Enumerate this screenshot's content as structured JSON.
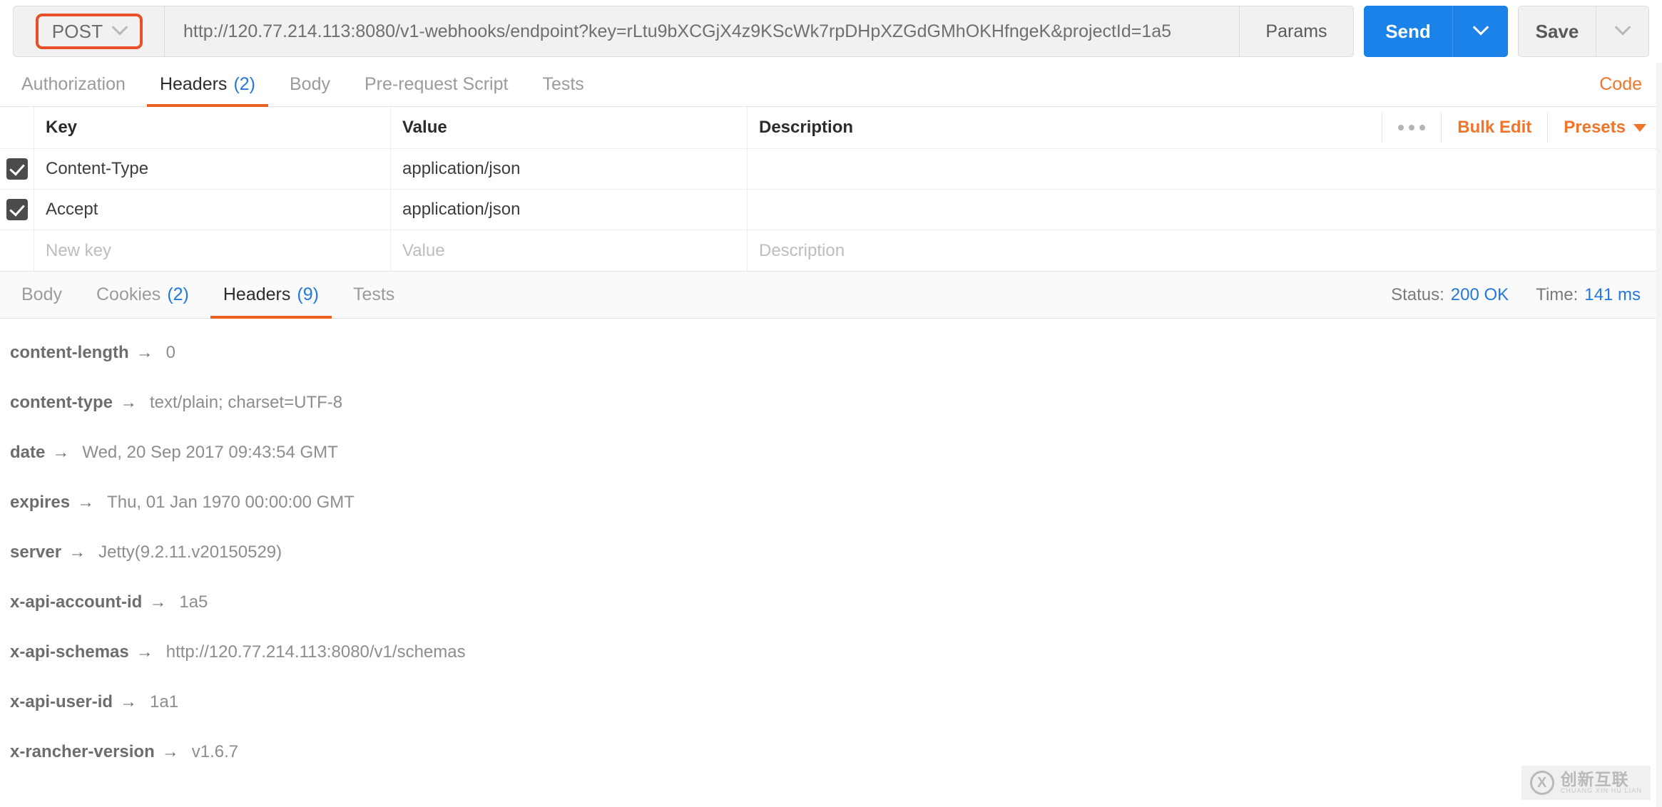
{
  "request": {
    "method": "POST",
    "url": "http://120.77.214.113:8080/v1-webhooks/endpoint?key=rLtu9bXCGjX4z9KScWk7rpDHpXZGdGMhOKHfngeK&projectId=1a5",
    "params_label": "Params",
    "send_label": "Send",
    "save_label": "Save",
    "method_caret_icon": "chevron-down-icon",
    "send_caret_icon": "chevron-down-icon",
    "save_caret_icon": "chevron-down-icon",
    "tabs": [
      {
        "label": "Authorization",
        "count": "",
        "active": false
      },
      {
        "label": "Headers",
        "count": "(2)",
        "active": true
      },
      {
        "label": "Body",
        "count": "",
        "active": false
      },
      {
        "label": "Pre-request Script",
        "count": "",
        "active": false
      },
      {
        "label": "Tests",
        "count": "",
        "active": false
      }
    ],
    "code_link": "Code"
  },
  "headers_table": {
    "columns": {
      "key": "Key",
      "value": "Value",
      "description": "Description"
    },
    "more_icon": "ellipsis-icon",
    "bulk_edit": "Bulk Edit",
    "presets": "Presets",
    "presets_caret_icon": "caret-down-icon",
    "rows": [
      {
        "checked": true,
        "key": "Content-Type",
        "value": "application/json",
        "description": ""
      },
      {
        "checked": true,
        "key": "Accept",
        "value": "application/json",
        "description": ""
      }
    ],
    "new_row": {
      "key_placeholder": "New key",
      "value_placeholder": "Value",
      "desc_placeholder": "Description"
    }
  },
  "response": {
    "tabs": [
      {
        "label": "Body",
        "count": "",
        "active": false
      },
      {
        "label": "Cookies",
        "count": "(2)",
        "active": false
      },
      {
        "label": "Headers",
        "count": "(9)",
        "active": true
      },
      {
        "label": "Tests",
        "count": "",
        "active": false
      }
    ],
    "status_label": "Status:",
    "status_value": "200 OK",
    "time_label": "Time:",
    "time_value": "141 ms",
    "arrow_glyph": "→",
    "headers": [
      {
        "name": "content-length",
        "value": "0"
      },
      {
        "name": "content-type",
        "value": "text/plain; charset=UTF-8"
      },
      {
        "name": "date",
        "value": "Wed, 20 Sep 2017 09:43:54 GMT"
      },
      {
        "name": "expires",
        "value": "Thu, 01 Jan 1970 00:00:00 GMT"
      },
      {
        "name": "server",
        "value": "Jetty(9.2.11.v20150529)"
      },
      {
        "name": "x-api-account-id",
        "value": "1a5"
      },
      {
        "name": "x-api-schemas",
        "value": "http://120.77.214.113:8080/v1/schemas"
      },
      {
        "name": "x-api-user-id",
        "value": "1a1"
      },
      {
        "name": "x-rancher-version",
        "value": "v1.6.7"
      }
    ]
  },
  "watermark": {
    "mark": "X",
    "cn": "创新互联",
    "en": "CHUANG XIN HU LIAN"
  },
  "colors": {
    "accent_orange": "#eb6121",
    "link_orange": "#f0752b",
    "send_blue": "#1b82e9",
    "info_blue": "#2278e0",
    "checkbox_gray": "#4b4b4b"
  }
}
